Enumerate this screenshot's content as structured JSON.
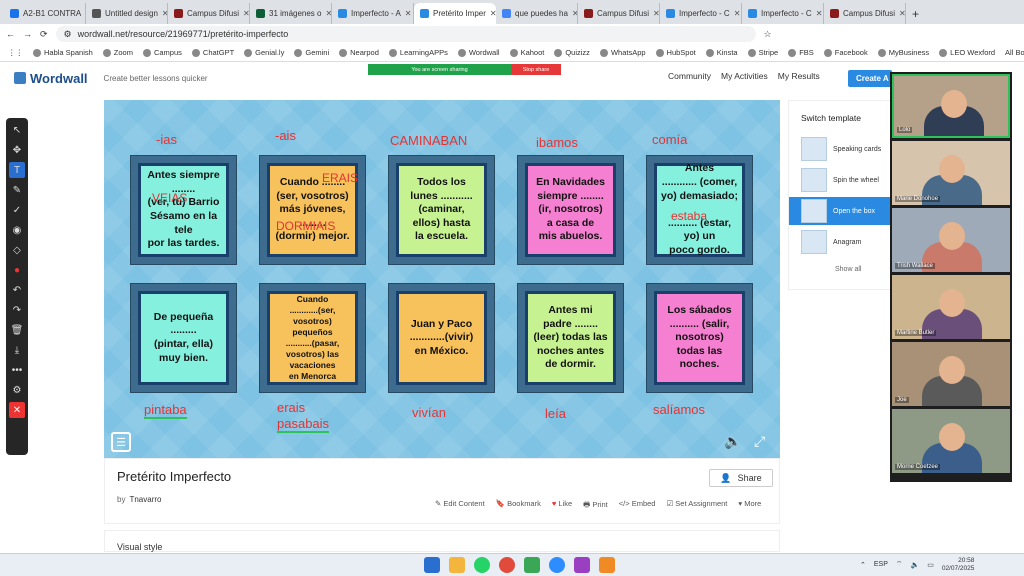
{
  "browser": {
    "tabs": [
      {
        "label": "A2-B1 CONTRA",
        "color": "#1a73e8"
      },
      {
        "label": "Untitled design",
        "color": "#555"
      },
      {
        "label": "Campus Difusi",
        "color": "#8b1a1a"
      },
      {
        "label": "31 imágenes o",
        "color": "#0b5e35"
      },
      {
        "label": "Imperfecto - A",
        "color": "#2a8ae2"
      },
      {
        "label": "Pretérito Imper",
        "color": "#2a8ae2",
        "active": true
      },
      {
        "label": "que puedes ha",
        "color": "#4285f4"
      },
      {
        "label": "Campus Difusi",
        "color": "#8b1a1a"
      },
      {
        "label": "Imperfecto - C",
        "color": "#2a8ae2"
      },
      {
        "label": "Imperfecto - C",
        "color": "#2a8ae2"
      },
      {
        "label": "Campus Difusi",
        "color": "#8b1a1a"
      }
    ],
    "url": "wordwall.net/resource/21969771/pretérito-imperfecto",
    "bookmarks": [
      "Habla Spanish",
      "Zoom",
      "Campus",
      "ChatGPT",
      "Genial.ly",
      "Gemini",
      "Nearpod",
      "LearningAPPs",
      "Wordwall",
      "Kahoot",
      "Quizizz",
      "WhatsApp",
      "HubSpot",
      "Kinsta",
      "Stripe",
      "FBS",
      "Facebook",
      "MyBusiness",
      "LEO Wexford"
    ],
    "all_bookmarks": "All Bookmarks"
  },
  "header": {
    "logo": "Wordwall",
    "tagline": "Create better lessons quicker",
    "nav": [
      "Community",
      "My Activities",
      "My Results"
    ],
    "create": "Create A",
    "sharing": "You are screen sharing",
    "stop": "Stop share"
  },
  "board": {
    "cards_top": [
      {
        "text": "Antes siempre\n........\n(ver, tú) Barrio\nSésamo en la tele\npor las tardes.",
        "color": "#86f0de"
      },
      {
        "text": "Cuando ........\n(ser, vosotros)\nmás jóvenes,\n.........\n(dormir) mejor.",
        "color": "#f7c15c"
      },
      {
        "text": "Todos los\nlunes ...........\n(caminar,\nellos) hasta\nla escuela.",
        "color": "#c7f291"
      },
      {
        "text": "En Navidades\nsiempre ........\n(ir, nosotros)\na casa de\nmis abuelos.",
        "color": "#f57fd0"
      },
      {
        "text": "Antes\n............ (comer,\nyo) demasiado;\n\n.......... (estar, yo) un\npoco gordo.",
        "color": "#86f0de"
      }
    ],
    "cards_bottom": [
      {
        "text": "De pequeña\n.........\n(pintar, ella)\nmuy bien.",
        "color": "#86f0de"
      },
      {
        "text": "Cuando\n............(ser,\nvosotros) pequeños\n...........(pasar,\nvosotros) las\nvacaciones\nen Menorca",
        "color": "#f7c15c"
      },
      {
        "text": "Juan y Paco\n............(vivir)\nen México.",
        "color": "#f7c15c"
      },
      {
        "text": "Antes mi\npadre ........\n(leer) todas las\nnoches antes\nde dormir.",
        "color": "#c7f291"
      },
      {
        "text": "Los sábados\n.......... (salir,\nnosotros)\ntodas las\nnoches.",
        "color": "#f57fd0"
      }
    ],
    "annotations_top": [
      "-ias",
      "-ais",
      "CAMINABAN",
      "ibamos",
      "comía"
    ],
    "annotations_overlay": [
      "VEIAS",
      "ERAIS",
      "DORMIAIS",
      "estaba"
    ],
    "annotations_bottom": [
      "pintaba",
      "erais",
      "pasabais",
      "vivían",
      "leía",
      "salíamos"
    ]
  },
  "info": {
    "title": "Pretérito Imperfecto",
    "by": "by",
    "author": "Tnavarro",
    "share": "Share",
    "actions": [
      "Edit Content",
      "Bookmark",
      "Like",
      "Print",
      "Embed",
      "Set Assignment",
      "More"
    ],
    "visual_style": "Visual style"
  },
  "templates": {
    "title": "Switch template",
    "items": [
      "Speaking cards",
      "Spin the wheel",
      "Open the box",
      "Anagram"
    ],
    "show_all": "Show all"
  },
  "participants": [
    "Lolo",
    "Marie Donohoe",
    "Trish Wallace",
    "Martine Butler",
    "Joe",
    "Morne Coetzee"
  ],
  "taskbar": {
    "lang": "ESP",
    "time": "20:58",
    "date": "02/07/2025"
  }
}
